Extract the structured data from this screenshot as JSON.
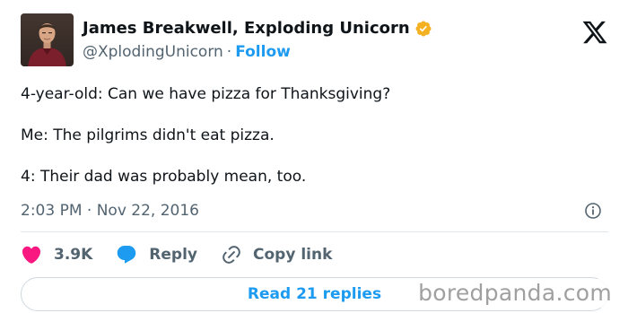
{
  "author": {
    "display_name": "James Breakwell, Exploding Unicorn",
    "handle": "@XplodingUnicorn",
    "separator": "·",
    "follow_label": "Follow",
    "verified_color": "#f4b223"
  },
  "tweet": {
    "lines": [
      "4-year-old: Can we have pizza for Thanksgiving?",
      "Me: The pilgrims didn't eat pizza.",
      "4: Their dad was probably mean, too."
    ],
    "timestamp": "2:03 PM · Nov 22, 2016"
  },
  "actions": {
    "likes": {
      "count": "3.9K",
      "color": "#f91880"
    },
    "reply": {
      "label": "Reply",
      "color": "#1d9bf0"
    },
    "copy_link": {
      "label": "Copy link"
    }
  },
  "read_replies_label": "Read 21 replies",
  "watermark": "boredpanda.com",
  "colors": {
    "text": "#0f1419",
    "secondary": "#536471",
    "accent": "#1d9bf0",
    "border": "#cfd9de"
  },
  "icons": [
    "verified-badge-icon",
    "x-logo-icon",
    "info-icon",
    "heart-icon",
    "reply-bubble-icon",
    "link-icon"
  ]
}
